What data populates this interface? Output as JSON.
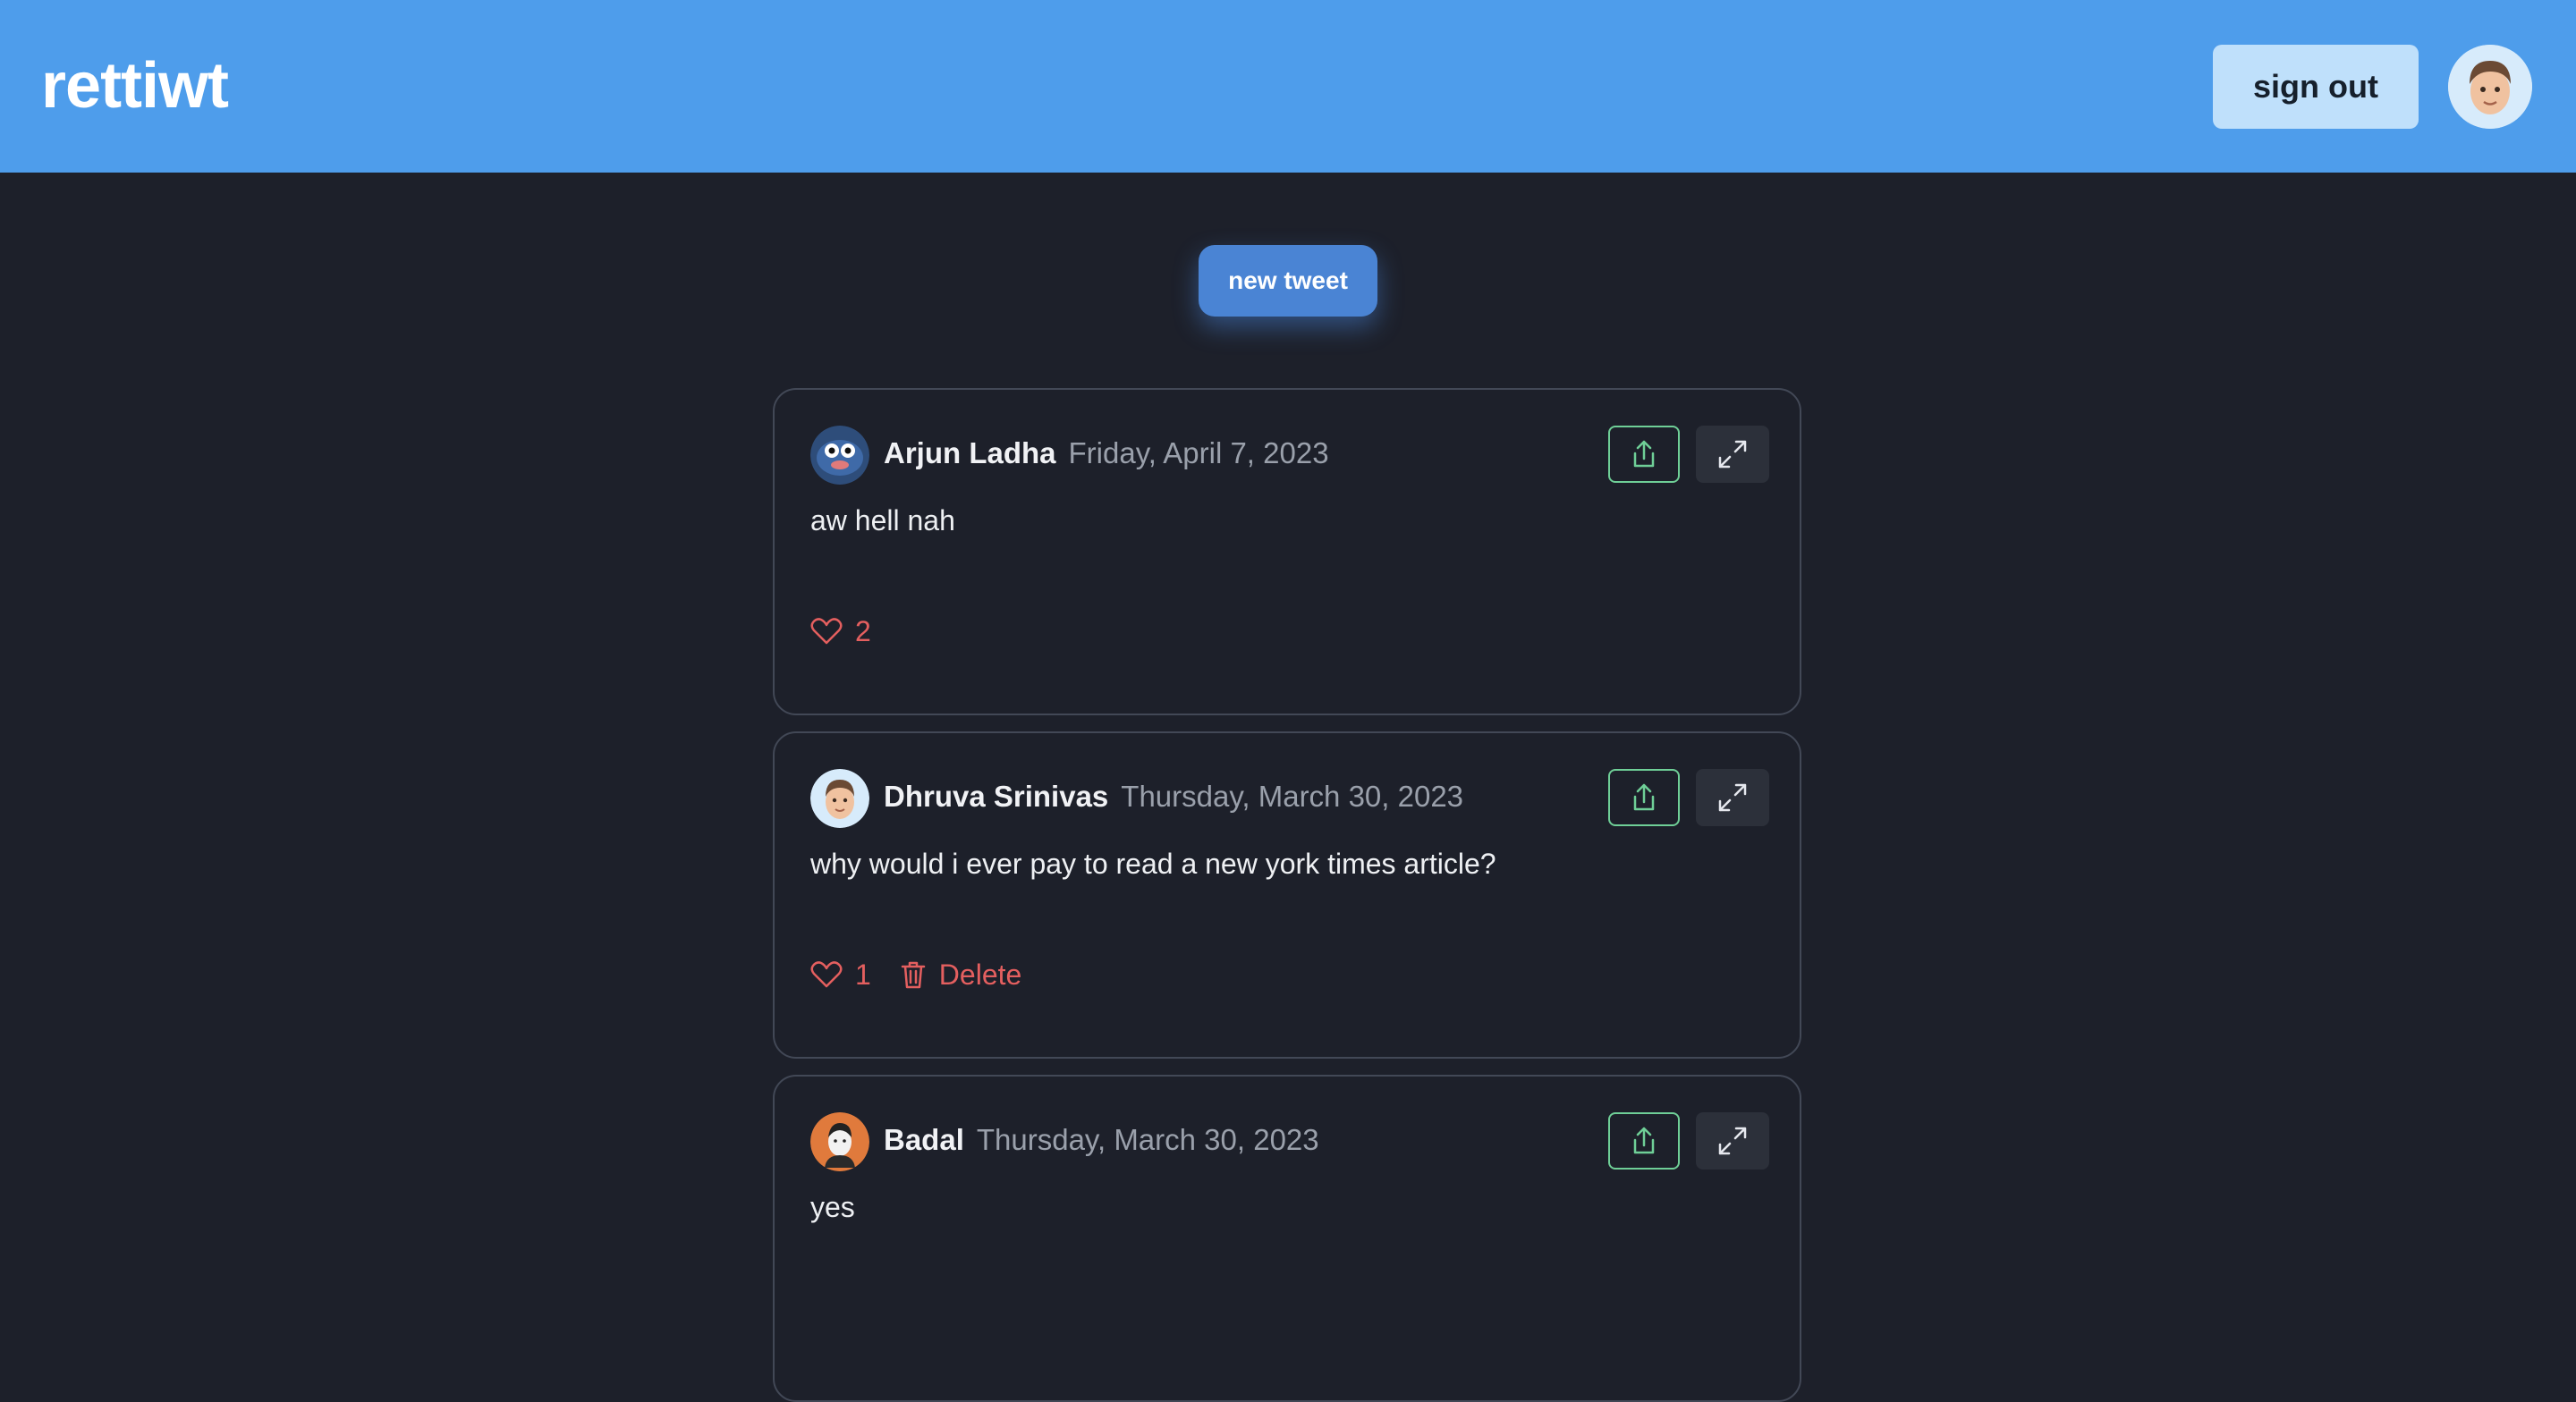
{
  "header": {
    "brand": "rettiwt",
    "sign_out_label": "sign out",
    "bg_color": "#4e9deb"
  },
  "compose": {
    "new_tweet_label": "new tweet"
  },
  "colors": {
    "like": "#e45f5f",
    "share_border": "#6fcf97",
    "card_border": "#424856",
    "page_bg": "#1d202a"
  },
  "tweets": [
    {
      "author": "Arjun Ladha",
      "date": "Friday, April 7, 2023",
      "text": "aw hell nah",
      "likes": "2",
      "delete_label": ""
    },
    {
      "author": "Dhruva Srinivas",
      "date": "Thursday, March 30, 2023",
      "text": "why would i ever pay to read a new york times article?",
      "likes": "1",
      "delete_label": "Delete"
    },
    {
      "author": "Badal",
      "date": "Thursday, March 30, 2023",
      "text": "yes",
      "likes": "",
      "delete_label": ""
    }
  ]
}
